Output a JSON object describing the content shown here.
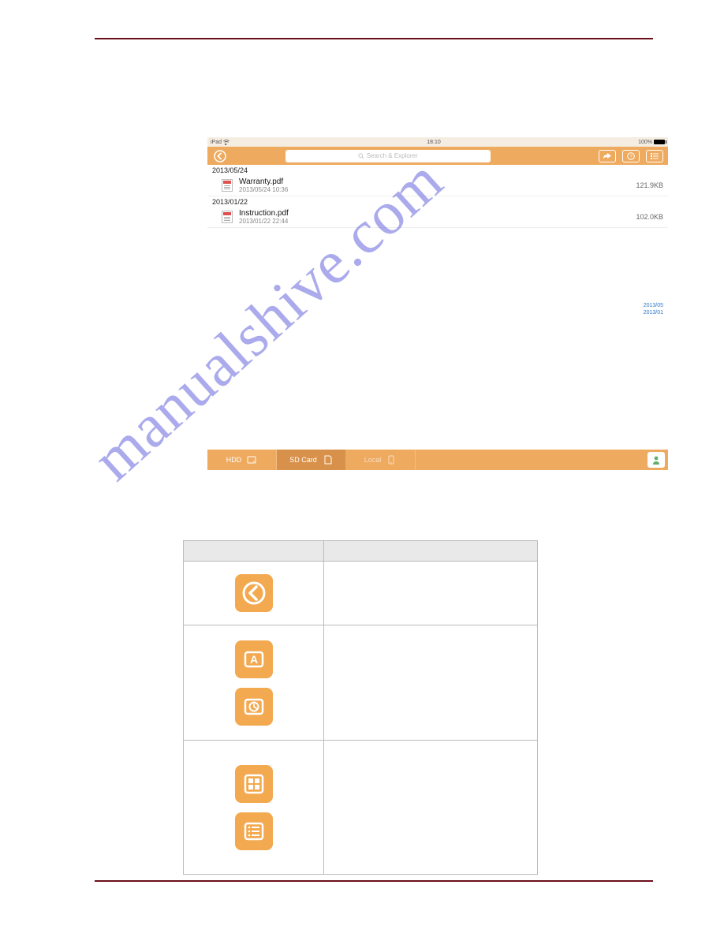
{
  "status": {
    "device": "iPad",
    "time": "18:10",
    "battery_text": "100%"
  },
  "nav": {
    "search_placeholder": "Search & Explorer"
  },
  "files": {
    "sections": [
      {
        "date": "2013/05/24",
        "items": [
          {
            "name": "Warranty.pdf",
            "ts": "2013/05/24 10:36",
            "size": "121.9KB"
          }
        ]
      },
      {
        "date": "2013/01/22",
        "items": [
          {
            "name": "Instruction.pdf",
            "ts": "2013/01/22 22:44",
            "size": "102.0KB"
          }
        ]
      }
    ]
  },
  "side_index": [
    "2013/05",
    "2013/01"
  ],
  "tabs": {
    "hdd": "HDD",
    "sd": "SD Card",
    "local": "Local"
  },
  "watermark": "manualshive.com"
}
